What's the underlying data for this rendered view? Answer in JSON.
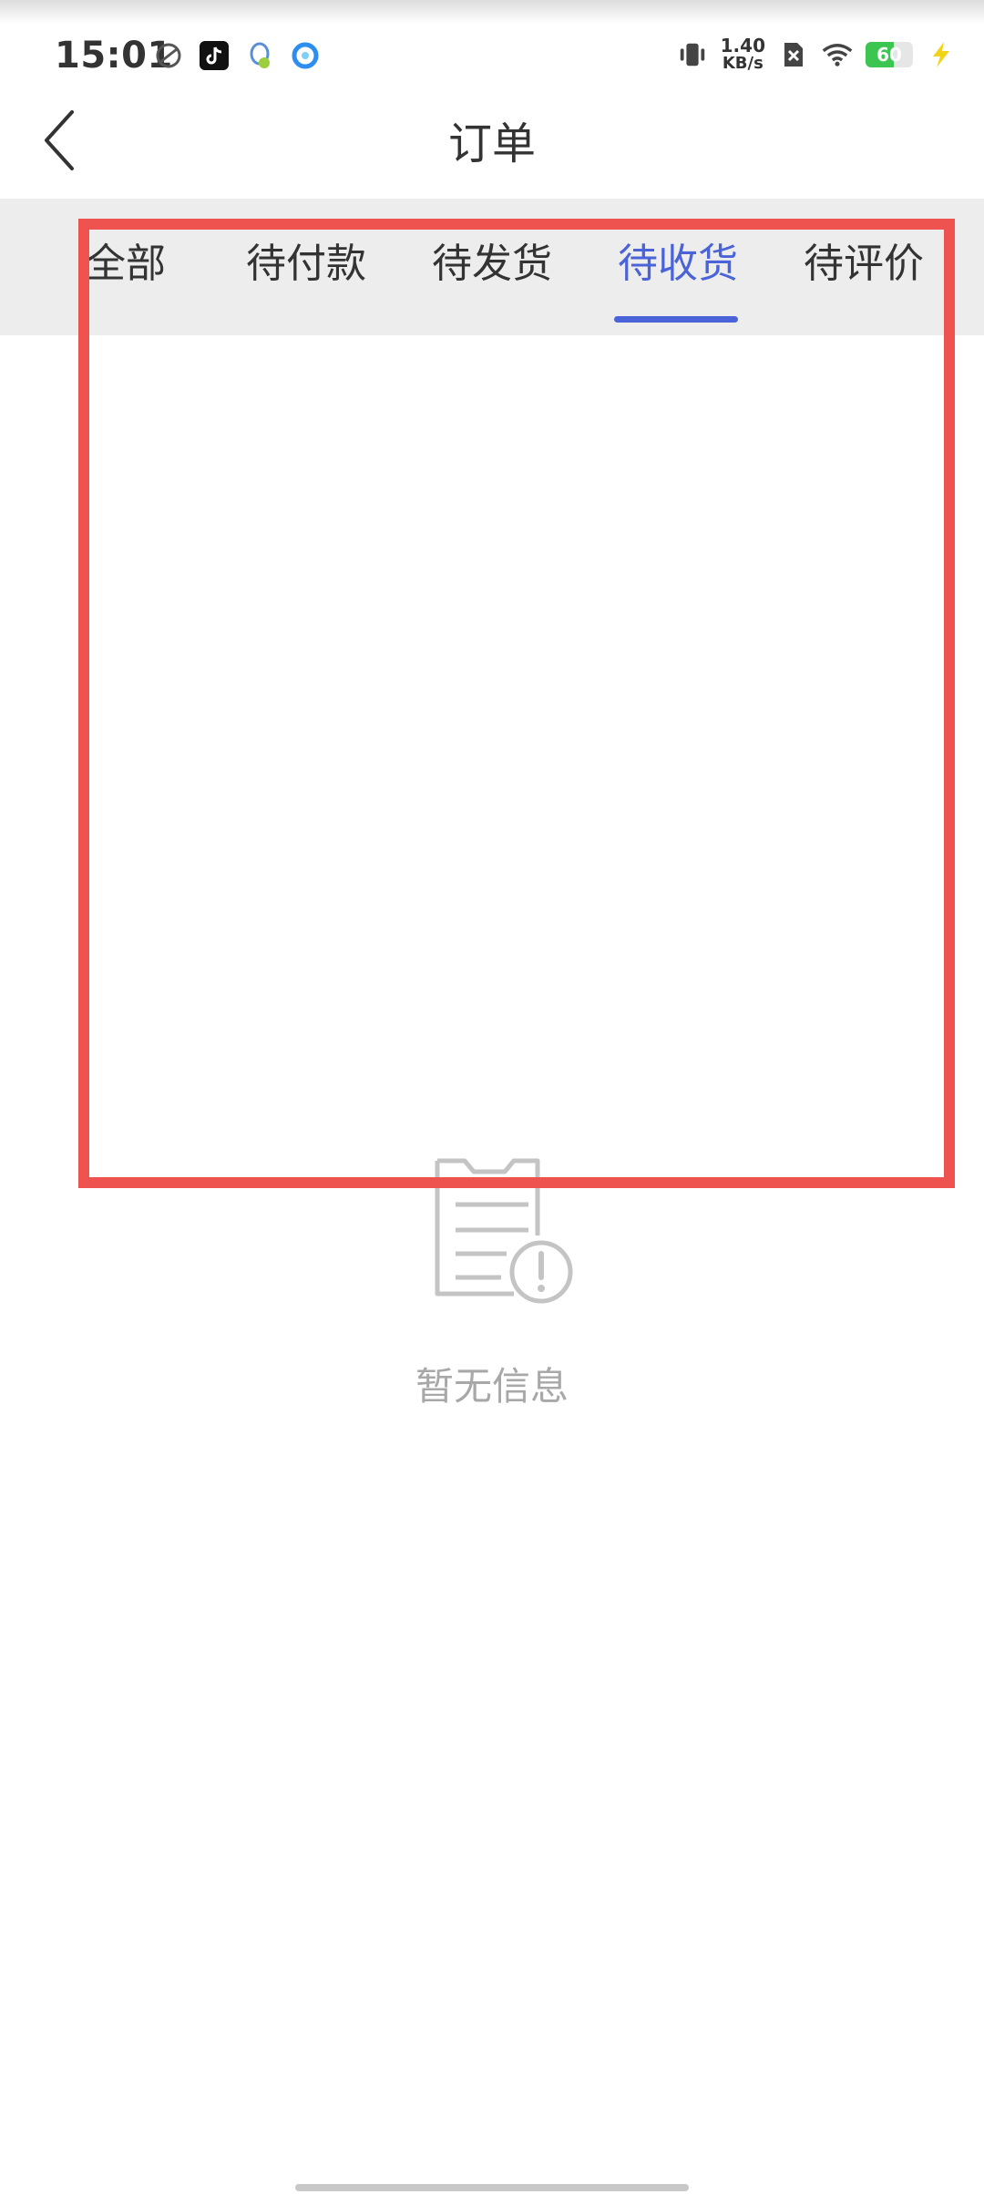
{
  "status_bar": {
    "time": "15:01",
    "left_icons": [
      "app-notification-icon",
      "tiktok-icon",
      "qq-icon",
      "browser-icon"
    ],
    "net_speed_value": "1.40",
    "net_speed_unit": "KB/s",
    "battery_level": "60",
    "battery_fraction": 0.6,
    "battery_color": "#3dc552",
    "right_icons": [
      "vibrate-icon",
      "sim-blocked-icon",
      "wifi-icon",
      "battery-icon",
      "charging-icon"
    ]
  },
  "nav": {
    "back_icon": "chevron-left-icon",
    "title": "订单"
  },
  "tabs": [
    {
      "label": "全部",
      "active": false
    },
    {
      "label": "待付款",
      "active": false
    },
    {
      "label": "待发货",
      "active": false
    },
    {
      "label": "待收货",
      "active": true
    },
    {
      "label": "待评价",
      "active": false
    }
  ],
  "accent_color": "#4a63d8",
  "empty_state": {
    "icon": "clipboard-alert-icon",
    "text": "暂无信息"
  },
  "overlay": {
    "highlight_color": "#ef5350"
  }
}
